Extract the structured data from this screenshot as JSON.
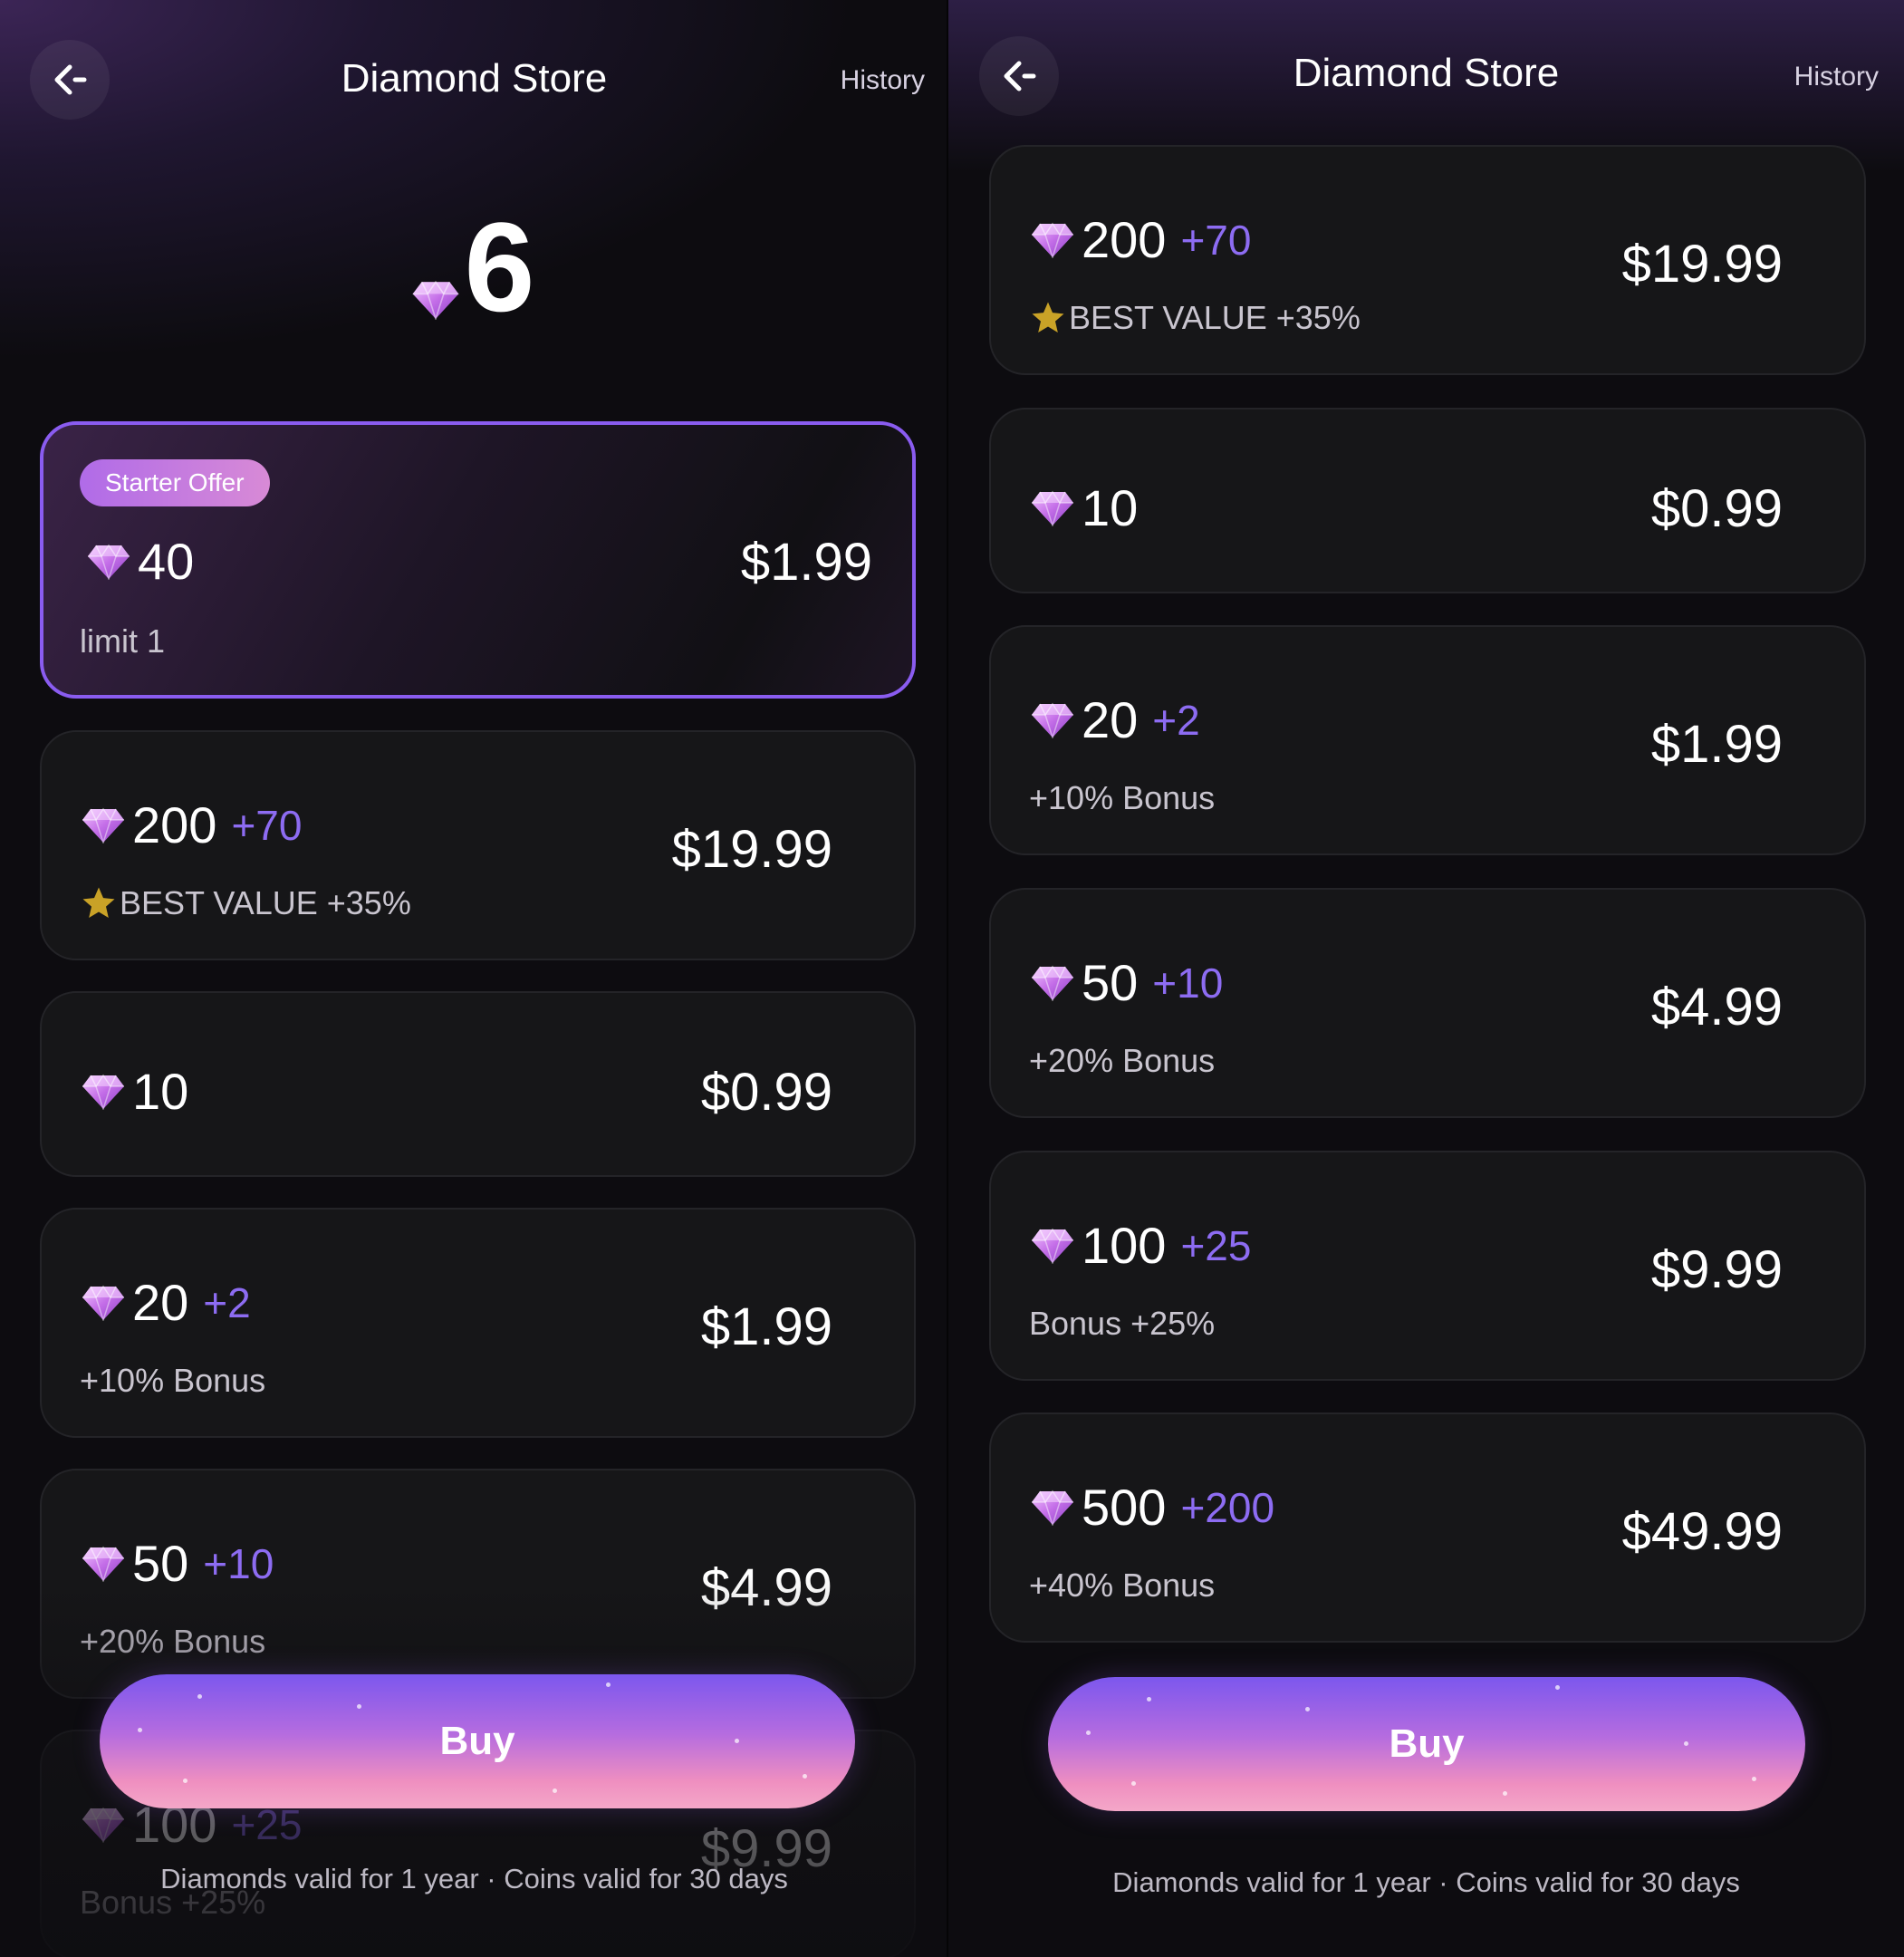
{
  "colors": {
    "accent": "#8a5cf0",
    "bonus_text": "#8d6cf2",
    "star": "#c9a227",
    "card_bg": "#161618"
  },
  "icons": {
    "back": "back-arrow-icon",
    "diamond": "diamond-icon",
    "star": "star-icon"
  },
  "left": {
    "header": {
      "title": "Diamond Store",
      "history_label": "History"
    },
    "balance": {
      "value": "6"
    },
    "starter": {
      "badge": "Starter Offer",
      "amount": "40",
      "price": "$1.99",
      "note": "limit 1"
    },
    "packages": [
      {
        "amount": "200",
        "bonus": "+70",
        "price": "$19.99",
        "note": "BEST VALUE +35%",
        "star": true
      },
      {
        "amount": "10",
        "bonus": "",
        "price": "$0.99",
        "note": "",
        "star": false
      },
      {
        "amount": "20",
        "bonus": "+2",
        "price": "$1.99",
        "note": "+10% Bonus",
        "star": false
      },
      {
        "amount": "50",
        "bonus": "+10",
        "price": "$4.99",
        "note": "+20% Bonus",
        "star": false
      },
      {
        "amount": "100",
        "bonus": "+25",
        "price": "$9.99",
        "note": "Bonus +25%",
        "star": false
      }
    ],
    "buy_label": "Buy",
    "footer": "Diamonds valid for 1 year · Coins valid for 30 days"
  },
  "right": {
    "header": {
      "title": "Diamond Store",
      "history_label": "History"
    },
    "packages": [
      {
        "amount": "200",
        "bonus": "+70",
        "price": "$19.99",
        "note": "BEST VALUE +35%",
        "star": true
      },
      {
        "amount": "10",
        "bonus": "",
        "price": "$0.99",
        "note": "",
        "star": false
      },
      {
        "amount": "20",
        "bonus": "+2",
        "price": "$1.99",
        "note": "+10% Bonus",
        "star": false
      },
      {
        "amount": "50",
        "bonus": "+10",
        "price": "$4.99",
        "note": "+20% Bonus",
        "star": false
      },
      {
        "amount": "100",
        "bonus": "+25",
        "price": "$9.99",
        "note": "Bonus +25%",
        "star": false
      },
      {
        "amount": "500",
        "bonus": "+200",
        "price": "$49.99",
        "note": "+40% Bonus",
        "star": false
      }
    ],
    "buy_label": "Buy",
    "footer": "Diamonds valid for 1 year · Coins valid for 30 days"
  }
}
